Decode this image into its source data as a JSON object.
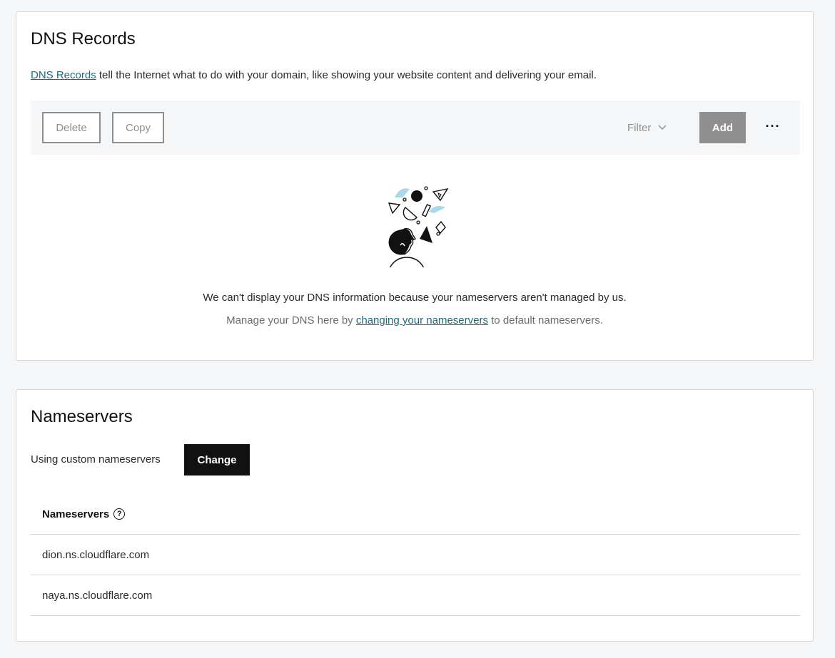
{
  "dns": {
    "title": "DNS Records",
    "desc_link": "DNS Records",
    "desc_text": " tell the Internet what to do with your domain, like showing your website content and delivering your email.",
    "toolbar": {
      "delete_label": "Delete",
      "copy_label": "Copy",
      "filter_label": "Filter",
      "add_label": "Add",
      "more_label": "···"
    },
    "empty_message": "We can't display your DNS information because your nameservers aren't managed by us.",
    "manage_prefix": "Manage your DNS here by ",
    "manage_link": "changing your nameservers",
    "manage_suffix": " to default nameservers."
  },
  "nameservers": {
    "title": "Nameservers",
    "status_text": "Using custom nameservers",
    "change_label": "Change",
    "table_header": "Nameservers",
    "help_glyph": "?",
    "rows": [
      "dion.ns.cloudflare.com",
      "naya.ns.cloudflare.com"
    ]
  },
  "colors": {
    "link": "#1e6b7a",
    "accent_light_blue": "#a8d8ea",
    "disabled_gray": "#8f8f8f"
  }
}
